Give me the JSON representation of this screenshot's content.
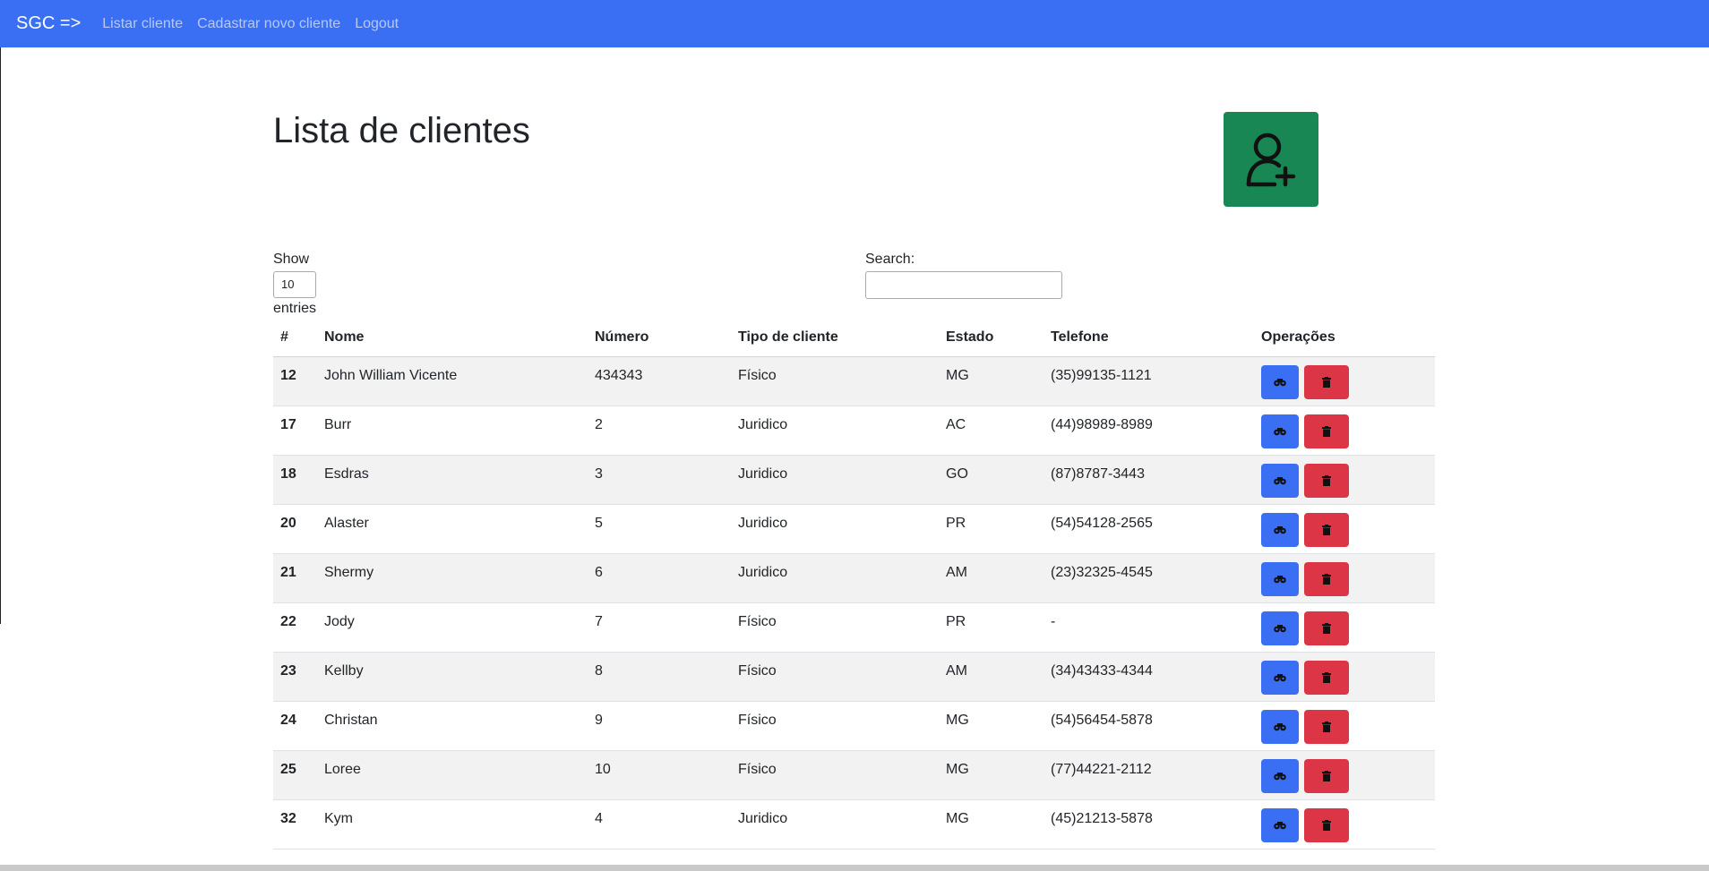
{
  "navbar": {
    "brand": "SGC =>",
    "links": [
      "Listar cliente",
      "Cadastrar novo cliente",
      "Logout"
    ],
    "color": "#3a6ff4"
  },
  "page": {
    "title": "Lista de clientes",
    "add_button_icon": "person-plus-icon",
    "add_button_color": "#198754"
  },
  "table_controls": {
    "show_label": "Show",
    "entries_value": "10",
    "entries_label": "entries",
    "search_label": "Search:",
    "search_value": ""
  },
  "table": {
    "headers": [
      "#",
      "Nome",
      "Número",
      "Tipo de cliente",
      "Estado",
      "Telefone",
      "Operações"
    ],
    "rows": [
      {
        "id": "12",
        "nome": "John William Vicente",
        "numero": "434343",
        "tipo": "Físico",
        "estado": "MG",
        "telefone": "(35)99135-1121"
      },
      {
        "id": "17",
        "nome": "Burr",
        "numero": "2",
        "tipo": "Juridico",
        "estado": "AC",
        "telefone": "(44)98989-8989"
      },
      {
        "id": "18",
        "nome": "Esdras",
        "numero": "3",
        "tipo": "Juridico",
        "estado": "GO",
        "telefone": "(87)8787-3443"
      },
      {
        "id": "20",
        "nome": "Alaster",
        "numero": "5",
        "tipo": "Juridico",
        "estado": "PR",
        "telefone": "(54)54128-2565"
      },
      {
        "id": "21",
        "nome": "Shermy",
        "numero": "6",
        "tipo": "Juridico",
        "estado": "AM",
        "telefone": "(23)32325-4545"
      },
      {
        "id": "22",
        "nome": "Jody",
        "numero": "7",
        "tipo": "Físico",
        "estado": "PR",
        "telefone": "-"
      },
      {
        "id": "23",
        "nome": "Kellby",
        "numero": "8",
        "tipo": "Físico",
        "estado": "AM",
        "telefone": "(34)43433-4344"
      },
      {
        "id": "24",
        "nome": "Christan",
        "numero": "9",
        "tipo": "Físico",
        "estado": "MG",
        "telefone": "(54)56454-5878"
      },
      {
        "id": "25",
        "nome": "Loree",
        "numero": "10",
        "tipo": "Físico",
        "estado": "MG",
        "telefone": "(77)44221-2112"
      },
      {
        "id": "32",
        "nome": "Kym",
        "numero": "4",
        "tipo": "Juridico",
        "estado": "MG",
        "telefone": "(45)21213-5878"
      }
    ],
    "view_icon": "binoculars-icon",
    "delete_icon": "trash-icon",
    "view_color": "#3a6ff4",
    "delete_color": "#dc3545"
  }
}
